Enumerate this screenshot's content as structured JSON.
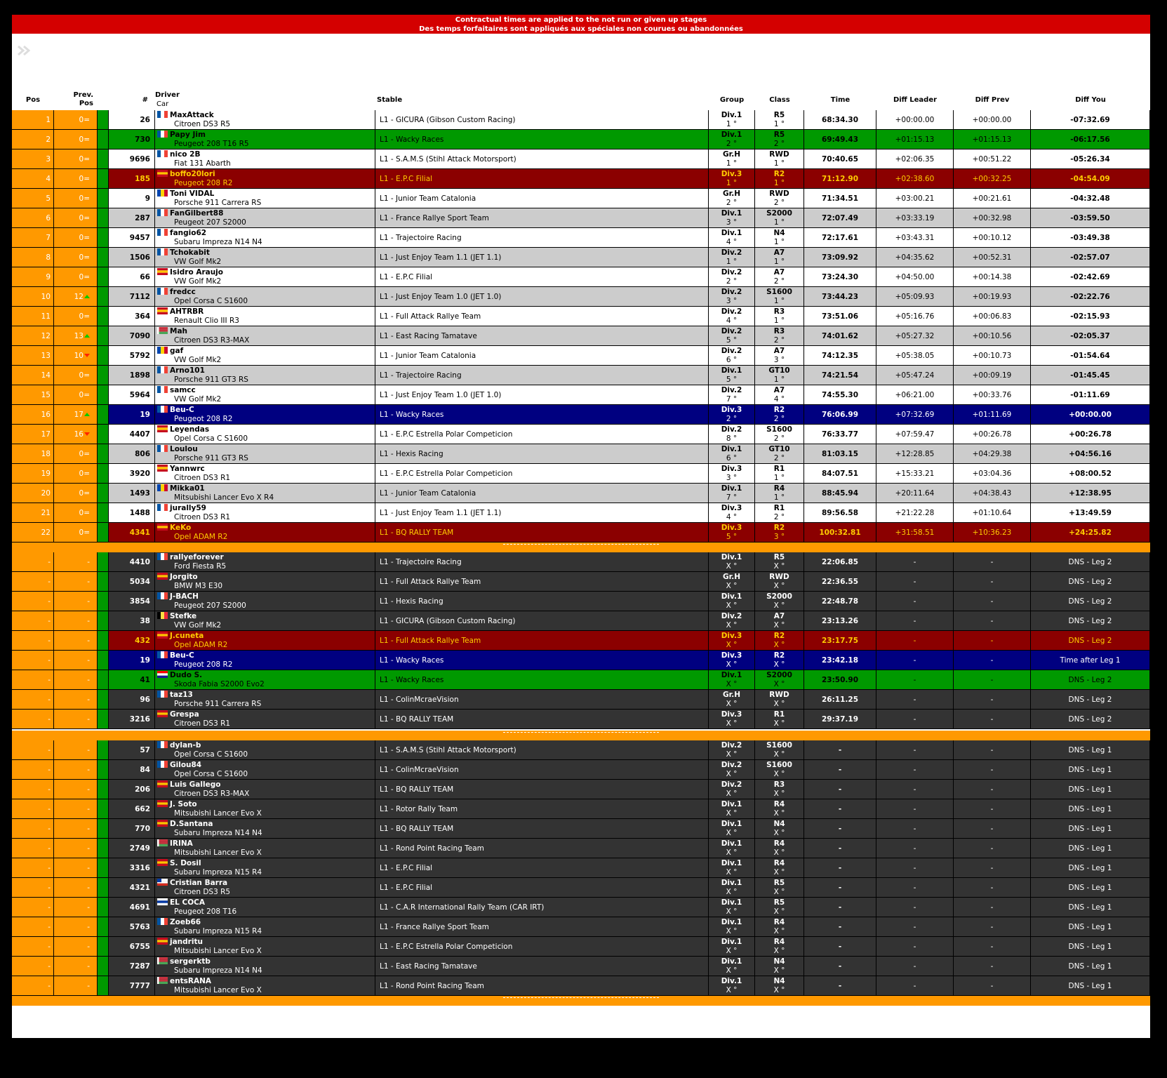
{
  "banner": {
    "line1": "Contractual times are applied to the not run or given up stages",
    "line2": "Des temps forfaitaires sont appliqués aux spéciales non courues ou abandonnées"
  },
  "nav": {
    "icon": "double-chevron-right-icon"
  },
  "colors": {
    "orange": "#ff9900",
    "green": "#009900",
    "red_banner": "#d40000",
    "dark_red": "#8b0000",
    "navy": "#000080",
    "dark_row": "#333333",
    "light_row": "#ffffff",
    "grey_row": "#cccccc",
    "gold_text": "#ffcc00"
  },
  "header": {
    "pos": "Pos",
    "prev1": "Prev.",
    "prev2": "Pos",
    "num": "#",
    "driver": "Driver",
    "car": "Car",
    "stable": "Stable",
    "group": "Group",
    "class": "Class",
    "time": "Time",
    "diff_leader": "Diff Leader",
    "diff_prev": "Diff Prev",
    "diff_you": "Diff You"
  },
  "finishers": [
    {
      "pos": "1",
      "prev": "0=",
      "move": "",
      "num": "26",
      "flag": "fr",
      "driver": "MaxAttack",
      "car": "Citroen DS3 R5",
      "stable": "L1 - GICURA (Gibson Custom Racing)",
      "group": "Div.1",
      "grank": "1 °",
      "cls": "R5",
      "crank": "1 °",
      "time": "68:34.30",
      "dl": "+00:00.00",
      "dp": "+00:00.00",
      "dy": "-07:32.69",
      "style": "white"
    },
    {
      "pos": "2",
      "prev": "0=",
      "move": "",
      "num": "730",
      "flag": "fr",
      "driver": "Papy Jim",
      "car": "Peugeot 208 T16 R5",
      "stable": "L1 - Wacky Races",
      "group": "Div.1",
      "grank": "2 °",
      "cls": "R5",
      "crank": "2 °",
      "time": "69:49.43",
      "dl": "+01:15.13",
      "dp": "+01:15.13",
      "dy": "-06:17.56",
      "style": "green"
    },
    {
      "pos": "3",
      "prev": "0=",
      "move": "",
      "num": "9696",
      "flag": "fr",
      "driver": "nico 2B",
      "car": "Fiat 131 Abarth",
      "stable": "L1 - S.A.M.S (Stihl Attack Motorsport)",
      "group": "Gr.H",
      "grank": "1 °",
      "cls": "RWD",
      "crank": "1 °",
      "time": "70:40.65",
      "dl": "+02:06.35",
      "dp": "+00:51.22",
      "dy": "-05:26.34",
      "style": "white"
    },
    {
      "pos": "4",
      "prev": "0=",
      "move": "",
      "num": "185",
      "flag": "es",
      "driver": "boffo20lori",
      "car": "Peugeot 208 R2",
      "stable": "L1 - E.P.C Filial",
      "group": "Div.3",
      "grank": "1 °",
      "cls": "R2",
      "crank": "1 °",
      "time": "71:12.90",
      "dl": "+02:38.60",
      "dp": "+00:32.25",
      "dy": "-04:54.09",
      "style": "darkred"
    },
    {
      "pos": "5",
      "prev": "0=",
      "move": "",
      "num": "9",
      "flag": "md",
      "driver": "Toni VIDAL",
      "car": "Porsche 911 Carrera RS",
      "stable": "L1 - Junior Team Catalonia",
      "group": "Gr.H",
      "grank": "2 °",
      "cls": "RWD",
      "crank": "2 °",
      "time": "71:34.51",
      "dl": "+03:00.21",
      "dp": "+00:21.61",
      "dy": "-04:32.48",
      "style": "white"
    },
    {
      "pos": "6",
      "prev": "0=",
      "move": "",
      "num": "287",
      "flag": "fr",
      "driver": "FanGilbert88",
      "car": "Peugeot 207 S2000",
      "stable": "L1 - France Rallye Sport Team",
      "group": "Div.1",
      "grank": "3 °",
      "cls": "S2000",
      "crank": "1 °",
      "time": "72:07.49",
      "dl": "+03:33.19",
      "dp": "+00:32.98",
      "dy": "-03:59.50",
      "style": "grey"
    },
    {
      "pos": "7",
      "prev": "0=",
      "move": "",
      "num": "9457",
      "flag": "fr",
      "driver": "fangio62",
      "car": "Subaru Impreza N14 N4",
      "stable": "L1 - Trajectoire Racing",
      "group": "Div.1",
      "grank": "4 °",
      "cls": "N4",
      "crank": "1 °",
      "time": "72:17.61",
      "dl": "+03:43.31",
      "dp": "+00:10.12",
      "dy": "-03:49.38",
      "style": "white"
    },
    {
      "pos": "8",
      "prev": "0=",
      "move": "",
      "num": "1506",
      "flag": "fr",
      "driver": "Tchokabit",
      "car": "VW Golf Mk2",
      "stable": "L1 - Just Enjoy Team 1.1 (JET 1.1)",
      "group": "Div.2",
      "grank": "1 °",
      "cls": "A7",
      "crank": "1 °",
      "time": "73:09.92",
      "dl": "+04:35.62",
      "dp": "+00:52.31",
      "dy": "-02:57.07",
      "style": "grey"
    },
    {
      "pos": "9",
      "prev": "0=",
      "move": "",
      "num": "66",
      "flag": "es",
      "driver": "Isidro Araujo",
      "car": "VW Golf Mk2",
      "stable": "L1 - E.P.C Filial",
      "group": "Div.2",
      "grank": "2 °",
      "cls": "A7",
      "crank": "2 °",
      "time": "73:24.30",
      "dl": "+04:50.00",
      "dp": "+00:14.38",
      "dy": "-02:42.69",
      "style": "white"
    },
    {
      "pos": "10",
      "prev": "12",
      "move": "up",
      "num": "7112",
      "flag": "fr",
      "driver": "fredcc",
      "car": "Opel Corsa C S1600",
      "stable": "L1 - Just Enjoy Team 1.0 (JET 1.0)",
      "group": "Div.2",
      "grank": "3 °",
      "cls": "S1600",
      "crank": "1 °",
      "time": "73:44.23",
      "dl": "+05:09.93",
      "dp": "+00:19.93",
      "dy": "-02:22.76",
      "style": "grey"
    },
    {
      "pos": "11",
      "prev": "0=",
      "move": "",
      "num": "364",
      "flag": "es",
      "driver": "AHTRBR",
      "car": "Renault Clio III R3",
      "stable": "L1 - Full Attack Rallye Team",
      "group": "Div.2",
      "grank": "4 °",
      "cls": "R3",
      "crank": "1 °",
      "time": "73:51.06",
      "dl": "+05:16.76",
      "dp": "+00:06.83",
      "dy": "-02:15.93",
      "style": "white"
    },
    {
      "pos": "12",
      "prev": "13",
      "move": "up",
      "num": "7090",
      "flag": "by",
      "driver": "Mah",
      "car": "Citroen DS3 R3-MAX",
      "stable": "L1 - East Racing Tamatave",
      "group": "Div.2",
      "grank": "5 °",
      "cls": "R3",
      "crank": "2 °",
      "time": "74:01.62",
      "dl": "+05:27.32",
      "dp": "+00:10.56",
      "dy": "-02:05.37",
      "style": "grey"
    },
    {
      "pos": "13",
      "prev": "10",
      "move": "down",
      "num": "5792",
      "flag": "md",
      "driver": "gaf",
      "car": "VW Golf Mk2",
      "stable": "L1 - Junior Team Catalonia",
      "group": "Div.2",
      "grank": "6 °",
      "cls": "A7",
      "crank": "3 °",
      "time": "74:12.35",
      "dl": "+05:38.05",
      "dp": "+00:10.73",
      "dy": "-01:54.64",
      "style": "white"
    },
    {
      "pos": "14",
      "prev": "0=",
      "move": "",
      "num": "1898",
      "flag": "fr",
      "driver": "Arno101",
      "car": "Porsche 911 GT3 RS",
      "stable": "L1 - Trajectoire Racing",
      "group": "Div.1",
      "grank": "5 °",
      "cls": "GT10",
      "crank": "1 °",
      "time": "74:21.54",
      "dl": "+05:47.24",
      "dp": "+00:09.19",
      "dy": "-01:45.45",
      "style": "grey"
    },
    {
      "pos": "15",
      "prev": "0=",
      "move": "",
      "num": "5964",
      "flag": "fr",
      "driver": "samcc",
      "car": "VW Golf Mk2",
      "stable": "L1 - Just Enjoy Team 1.0 (JET 1.0)",
      "group": "Div.2",
      "grank": "7 °",
      "cls": "A7",
      "crank": "4 °",
      "time": "74:55.30",
      "dl": "+06:21.00",
      "dp": "+00:33.76",
      "dy": "-01:11.69",
      "style": "white"
    },
    {
      "pos": "16",
      "prev": "17",
      "move": "up",
      "num": "19",
      "flag": "fr",
      "driver": "Beu-C",
      "car": "Peugeot 208 R2",
      "stable": "L1 - Wacky Races",
      "group": "Div.3",
      "grank": "2 °",
      "cls": "R2",
      "crank": "2 °",
      "time": "76:06.99",
      "dl": "+07:32.69",
      "dp": "+01:11.69",
      "dy": "+00:00.00",
      "style": "navy"
    },
    {
      "pos": "17",
      "prev": "16",
      "move": "down",
      "num": "4407",
      "flag": "es",
      "driver": "Leyendas",
      "car": "Opel Corsa C S1600",
      "stable": "L1 - E.P.C Estrella Polar Competicion",
      "group": "Div.2",
      "grank": "8 °",
      "cls": "S1600",
      "crank": "2 °",
      "time": "76:33.77",
      "dl": "+07:59.47",
      "dp": "+00:26.78",
      "dy": "+00:26.78",
      "style": "white"
    },
    {
      "pos": "18",
      "prev": "0=",
      "move": "",
      "num": "806",
      "flag": "fr",
      "driver": "Loulou",
      "car": "Porsche 911 GT3 RS",
      "stable": "L1 - Hexis Racing",
      "group": "Div.1",
      "grank": "6 °",
      "cls": "GT10",
      "crank": "2 °",
      "time": "81:03.15",
      "dl": "+12:28.85",
      "dp": "+04:29.38",
      "dy": "+04:56.16",
      "style": "grey"
    },
    {
      "pos": "19",
      "prev": "0=",
      "move": "",
      "num": "3920",
      "flag": "es",
      "driver": "Yannwrc",
      "car": "Citroen DS3 R1",
      "stable": "L1 - E.P.C Estrella Polar Competicion",
      "group": "Div.3",
      "grank": "3 °",
      "cls": "R1",
      "crank": "1 °",
      "time": "84:07.51",
      "dl": "+15:33.21",
      "dp": "+03:04.36",
      "dy": "+08:00.52",
      "style": "white"
    },
    {
      "pos": "20",
      "prev": "0=",
      "move": "",
      "num": "1493",
      "flag": "md",
      "driver": "Mikka01",
      "car": "Mitsubishi Lancer Evo X R4",
      "stable": "L1 - Junior Team Catalonia",
      "group": "Div.1",
      "grank": "7 °",
      "cls": "R4",
      "crank": "1 °",
      "time": "88:45.94",
      "dl": "+20:11.64",
      "dp": "+04:38.43",
      "dy": "+12:38.95",
      "style": "grey"
    },
    {
      "pos": "21",
      "prev": "0=",
      "move": "",
      "num": "1488",
      "flag": "fr",
      "driver": "jurally59",
      "car": "Citroen DS3 R1",
      "stable": "L1 - Just Enjoy Team 1.1 (JET 1.1)",
      "group": "Div.3",
      "grank": "4 °",
      "cls": "R1",
      "crank": "2 °",
      "time": "89:56.58",
      "dl": "+21:22.28",
      "dp": "+01:10.64",
      "dy": "+13:49.59",
      "style": "white"
    },
    {
      "pos": "22",
      "prev": "0=",
      "move": "",
      "num": "4341",
      "flag": "es",
      "driver": "KeKo",
      "car": "Opel ADAM R2",
      "stable": "L1 - BQ RALLY TEAM",
      "group": "Div.3",
      "grank": "5 °",
      "cls": "R2",
      "crank": "3 °",
      "time": "100:32.81",
      "dl": "+31:58.51",
      "dp": "+10:36.23",
      "dy": "+24:25.82",
      "style": "darkred"
    }
  ],
  "leg2": [
    {
      "pos": "-",
      "prev": "-",
      "move": "",
      "num": "4410",
      "flag": "fr",
      "driver": "rallyeforever",
      "car": "Ford Fiesta R5",
      "stable": "L1 - Trajectoire Racing",
      "group": "Div.1",
      "grank": "X °",
      "cls": "R5",
      "crank": "X °",
      "time": "22:06.85",
      "dl": "-",
      "dp": "-",
      "dy": "DNS - Leg 2",
      "style": "dark"
    },
    {
      "pos": "-",
      "prev": "-",
      "move": "",
      "num": "5034",
      "flag": "es",
      "driver": "Jorgito",
      "car": "BMW M3 E30",
      "stable": "L1 - Full Attack Rallye Team",
      "group": "Gr.H",
      "grank": "X °",
      "cls": "RWD",
      "crank": "X °",
      "time": "22:36.55",
      "dl": "-",
      "dp": "-",
      "dy": "DNS - Leg 2",
      "style": "dark"
    },
    {
      "pos": "-",
      "prev": "-",
      "move": "",
      "num": "3854",
      "flag": "fr",
      "driver": "J-BACH",
      "car": "Peugeot 207 S2000",
      "stable": "L1 - Hexis Racing",
      "group": "Div.1",
      "grank": "X °",
      "cls": "S2000",
      "crank": "X °",
      "time": "22:48.78",
      "dl": "-",
      "dp": "-",
      "dy": "DNS - Leg 2",
      "style": "dark"
    },
    {
      "pos": "-",
      "prev": "-",
      "move": "",
      "num": "38",
      "flag": "be",
      "driver": "Stefke",
      "car": "VW Golf Mk2",
      "stable": "L1 - GICURA (Gibson Custom Racing)",
      "group": "Div.2",
      "grank": "X °",
      "cls": "A7",
      "crank": "X °",
      "time": "23:13.26",
      "dl": "-",
      "dp": "-",
      "dy": "DNS - Leg 2",
      "style": "dark"
    },
    {
      "pos": "-",
      "prev": "-",
      "move": "",
      "num": "432",
      "flag": "es",
      "driver": "J.cuneta",
      "car": "Opel ADAM R2",
      "stable": "L1 - Full Attack Rallye Team",
      "group": "Div.3",
      "grank": "X °",
      "cls": "R2",
      "crank": "X °",
      "time": "23:17.75",
      "dl": "-",
      "dp": "-",
      "dy": "DNS - Leg 2",
      "style": "darkred"
    },
    {
      "pos": "-",
      "prev": "-",
      "move": "",
      "num": "19",
      "flag": "fr",
      "driver": "Beu-C",
      "car": "Peugeot 208 R2",
      "stable": "L1 - Wacky Races",
      "group": "Div.3",
      "grank": "X °",
      "cls": "R2",
      "crank": "X °",
      "time": "23:42.18",
      "dl": "-",
      "dp": "-",
      "dy": "Time after Leg 1",
      "style": "navy"
    },
    {
      "pos": "-",
      "prev": "-",
      "move": "",
      "num": "41",
      "flag": "hr",
      "driver": "Dudo S.",
      "car": "Skoda Fabia S2000 Evo2",
      "stable": "L1 - Wacky Races",
      "group": "Div.1",
      "grank": "X °",
      "cls": "S2000",
      "crank": "X °",
      "time": "23:50.90",
      "dl": "-",
      "dp": "-",
      "dy": "DNS - Leg 2",
      "style": "green"
    },
    {
      "pos": "-",
      "prev": "-",
      "move": "",
      "num": "96",
      "flag": "fr",
      "driver": "taz13",
      "car": "Porsche 911 Carrera RS",
      "stable": "L1 - ColinMcraeVision",
      "group": "Gr.H",
      "grank": "X °",
      "cls": "RWD",
      "crank": "X °",
      "time": "26:11.25",
      "dl": "-",
      "dp": "-",
      "dy": "DNS - Leg 2",
      "style": "dark"
    },
    {
      "pos": "-",
      "prev": "-",
      "move": "",
      "num": "3216",
      "flag": "es",
      "driver": "Grespa",
      "car": "Citroen DS3 R1",
      "stable": "L1 - BQ RALLY TEAM",
      "group": "Div.3",
      "grank": "X °",
      "cls": "R1",
      "crank": "X °",
      "time": "29:37.19",
      "dl": "-",
      "dp": "-",
      "dy": "DNS - Leg 2",
      "style": "dark"
    }
  ],
  "leg1": [
    {
      "pos": "-",
      "prev": "-",
      "move": "",
      "num": "57",
      "flag": "fr",
      "driver": "dylan-b",
      "car": "Opel Corsa C S1600",
      "stable": "L1 - S.A.M.S (Stihl Attack Motorsport)",
      "group": "Div.2",
      "grank": "X °",
      "cls": "S1600",
      "crank": "X °",
      "time": "-",
      "dl": "-",
      "dp": "-",
      "dy": "DNS - Leg 1",
      "style": "dark"
    },
    {
      "pos": "-",
      "prev": "-",
      "move": "",
      "num": "84",
      "flag": "fr",
      "driver": "Gilou84",
      "car": "Opel Corsa C S1600",
      "stable": "L1 - ColinMcraeVision",
      "group": "Div.2",
      "grank": "X °",
      "cls": "S1600",
      "crank": "X °",
      "time": "-",
      "dl": "-",
      "dp": "-",
      "dy": "DNS - Leg 1",
      "style": "dark"
    },
    {
      "pos": "-",
      "prev": "-",
      "move": "",
      "num": "206",
      "flag": "es",
      "driver": "Luis Gallego",
      "car": "Citroen DS3 R3-MAX",
      "stable": "L1 - BQ RALLY TEAM",
      "group": "Div.2",
      "grank": "X °",
      "cls": "R3",
      "crank": "X °",
      "time": "-",
      "dl": "-",
      "dp": "-",
      "dy": "DNS - Leg 1",
      "style": "dark"
    },
    {
      "pos": "-",
      "prev": "-",
      "move": "",
      "num": "662",
      "flag": "es",
      "driver": "J. Soto",
      "car": "Mitsubishi Lancer Evo X",
      "stable": "L1 - Rotor Rally Team",
      "group": "Div.1",
      "grank": "X °",
      "cls": "R4",
      "crank": "X °",
      "time": "-",
      "dl": "-",
      "dp": "-",
      "dy": "DNS - Leg 1",
      "style": "dark"
    },
    {
      "pos": "-",
      "prev": "-",
      "move": "",
      "num": "770",
      "flag": "es",
      "driver": "D.Santana",
      "car": "Subaru Impreza N14 N4",
      "stable": "L1 - BQ RALLY TEAM",
      "group": "Div.1",
      "grank": "X °",
      "cls": "N4",
      "crank": "X °",
      "time": "-",
      "dl": "-",
      "dp": "-",
      "dy": "DNS - Leg 1",
      "style": "dark"
    },
    {
      "pos": "-",
      "prev": "-",
      "move": "",
      "num": "2749",
      "flag": "by",
      "driver": "IRINA",
      "car": "Mitsubishi Lancer Evo X",
      "stable": "L1 - Rond Point Racing Team",
      "group": "Div.1",
      "grank": "X °",
      "cls": "R4",
      "crank": "X °",
      "time": "-",
      "dl": "-",
      "dp": "-",
      "dy": "DNS - Leg 1",
      "style": "dark"
    },
    {
      "pos": "-",
      "prev": "-",
      "move": "",
      "num": "3316",
      "flag": "es",
      "driver": "S. Dosil",
      "car": "Subaru Impreza N15 R4",
      "stable": "L1 - E.P.C Filial",
      "group": "Div.1",
      "grank": "X °",
      "cls": "R4",
      "crank": "X °",
      "time": "-",
      "dl": "-",
      "dp": "-",
      "dy": "DNS - Leg 1",
      "style": "dark"
    },
    {
      "pos": "-",
      "prev": "-",
      "move": "",
      "num": "4321",
      "flag": "cl",
      "driver": "Cristian Barra",
      "car": "Citroen DS3 R5",
      "stable": "L1 - E.P.C Filial",
      "group": "Div.1",
      "grank": "X °",
      "cls": "R5",
      "crank": "X °",
      "time": "-",
      "dl": "-",
      "dp": "-",
      "dy": "DNS - Leg 1",
      "style": "dark"
    },
    {
      "pos": "-",
      "prev": "-",
      "move": "",
      "num": "4691",
      "flag": "uy",
      "driver": "EL COCA",
      "car": "Peugeot 208 T16",
      "stable": "L1 - C.A.R International Rally Team (CAR IRT)",
      "group": "Div.1",
      "grank": "X °",
      "cls": "R5",
      "crank": "X °",
      "time": "-",
      "dl": "-",
      "dp": "-",
      "dy": "DNS - Leg 1",
      "style": "dark"
    },
    {
      "pos": "-",
      "prev": "-",
      "move": "",
      "num": "5763",
      "flag": "fr",
      "driver": "Zoeb66",
      "car": "Subaru Impreza N15 R4",
      "stable": "L1 - France Rallye Sport Team",
      "group": "Div.1",
      "grank": "X °",
      "cls": "R4",
      "crank": "X °",
      "time": "-",
      "dl": "-",
      "dp": "-",
      "dy": "DNS - Leg 1",
      "style": "dark"
    },
    {
      "pos": "-",
      "prev": "-",
      "move": "",
      "num": "6755",
      "flag": "es",
      "driver": "jandritu",
      "car": "Mitsubishi Lancer Evo X",
      "stable": "L1 - E.P.C Estrella Polar Competicion",
      "group": "Div.1",
      "grank": "X °",
      "cls": "R4",
      "crank": "X °",
      "time": "-",
      "dl": "-",
      "dp": "-",
      "dy": "DNS - Leg 1",
      "style": "dark"
    },
    {
      "pos": "-",
      "prev": "-",
      "move": "",
      "num": "7287",
      "flag": "by",
      "driver": "sergerktb",
      "car": "Subaru Impreza N14 N4",
      "stable": "L1 - East Racing Tamatave",
      "group": "Div.1",
      "grank": "X °",
      "cls": "N4",
      "crank": "X °",
      "time": "-",
      "dl": "-",
      "dp": "-",
      "dy": "DNS - Leg 1",
      "style": "dark"
    },
    {
      "pos": "-",
      "prev": "-",
      "move": "",
      "num": "7777",
      "flag": "by",
      "driver": "entsRANA",
      "car": "Mitsubishi Lancer Evo X",
      "stable": "L1 - Rond Point Racing Team",
      "group": "Div.1",
      "grank": "X °",
      "cls": "N4",
      "crank": "X °",
      "time": "-",
      "dl": "-",
      "dp": "-",
      "dy": "DNS - Leg 1",
      "style": "dark"
    }
  ]
}
